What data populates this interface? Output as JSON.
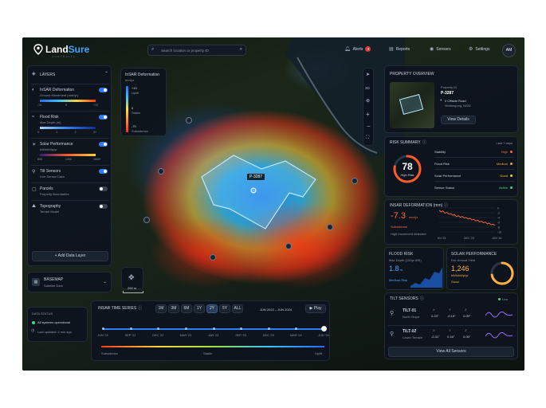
{
  "header": {
    "logo_land": "Land",
    "logo_sure": "Sure",
    "logo_sub": "AUSTRALIA",
    "search_placeholder": "Search location or property ID",
    "alerts": "Alerts",
    "alerts_count": "3",
    "reports": "Reports",
    "sensors": "Sensors",
    "settings": "Settings",
    "avatar": "AM"
  },
  "layers": {
    "title": "LAYERS",
    "items": [
      {
        "name": "InSAR Deformation",
        "sub": "Ground Movement (mm/yr)",
        "ticks": [
          "-70",
          "0",
          "+10"
        ],
        "on": true
      },
      {
        "name": "Flood Risk",
        "sub": "Max Depth (m)",
        "ticks": [
          "0",
          "1",
          "2",
          "3+"
        ],
        "on": true
      },
      {
        "name": "Solar Performance",
        "sub": "kWh/kWp/yr",
        "ticks": [
          "800",
          "1200",
          "1600+"
        ],
        "on": true
      },
      {
        "name": "Tilt Sensors",
        "sub": "Live Sensor Data",
        "on": true
      },
      {
        "name": "Parcels",
        "sub": "Property Boundaries",
        "on": false
      },
      {
        "name": "Topography",
        "sub": "Terrain Model",
        "on": false
      }
    ],
    "add": "+ Add Data Layer"
  },
  "basemap": {
    "title": "BASEMAP",
    "value": "Satellite Dark"
  },
  "data_status": {
    "title": "DATA STATUS",
    "status": "All systems operational",
    "updated": "Last updated: 2 min ago"
  },
  "legend": {
    "title": "InSAR Deformation",
    "unit": "mm/yr",
    "labels": [
      "+10",
      "Uplift",
      "0",
      "Stable",
      "-70",
      "Subsidence"
    ]
  },
  "map": {
    "parcel_label": "P-3287",
    "scale": "200 m",
    "tools": [
      "3D"
    ]
  },
  "timeseries": {
    "title": "INSAR TIME SERIES",
    "ranges": [
      "1M",
      "3M",
      "6M",
      "1Y",
      "2Y",
      "5Y",
      "ALL"
    ],
    "active": "2Y",
    "period": "JUN 2022 – JUN 2024",
    "play": "Play",
    "dates": [
      "JUN '22",
      "SEP '22",
      "DEC '22",
      "MAR '23",
      "JUN '23",
      "SEP '23",
      "DEC '23",
      "MAR '24",
      "JUN '24"
    ],
    "legend": [
      "Subsidence",
      "Stable",
      "Uplift"
    ]
  },
  "property": {
    "title": "PROPERTY OVERVIEW",
    "id_label": "Property ID",
    "id": "P-3287",
    "address1": "0 Offside Road",
    "address2": "Wollongong, NSW",
    "details_btn": "View Details"
  },
  "risk": {
    "title": "RISK SUMMARY",
    "period": "Last 7 days",
    "score": "78",
    "score_label": "High Risk",
    "score_fraction": 0.78,
    "rows": [
      {
        "label": "Stability",
        "value": "High",
        "color": "#ff6a3c"
      },
      {
        "label": "Flood Risk",
        "value": "Medium",
        "color": "#f2a52c"
      },
      {
        "label": "Solar Performance",
        "value": "Good",
        "color": "#f2d22c"
      },
      {
        "label": "Sensor Status",
        "value": "Active",
        "color": "#3ddc84"
      }
    ]
  },
  "insar": {
    "title": "INSAR DEFORMATION (mm)",
    "value": "-7.3",
    "unit": "mm/yr",
    "status": "Subsidence",
    "note": "High movement detected",
    "x_ticks": [
      "JUN '23",
      "DEC '23",
      "JUN '24"
    ],
    "y_ticks": [
      "0",
      "-2",
      "-4",
      "-6",
      "-8",
      "-10"
    ],
    "series": [
      -1.0,
      -1.6,
      -1.2,
      -2.2,
      -1.8,
      -2.6,
      -2.4,
      -3.0,
      -2.8,
      -3.6,
      -3.2,
      -3.9,
      -3.5,
      -4.2,
      -4.0,
      -4.6,
      -4.3,
      -5.0,
      -4.7,
      -5.4,
      -5.1,
      -5.8,
      -5.5,
      -6.2,
      -5.9,
      -6.6,
      -6.3,
      -7.0,
      -6.8,
      -7.3
    ]
  },
  "flood": {
    "title": "FLOOD RISK",
    "sub": "Max Depth (100yr ARI)",
    "value": "1.8",
    "unit": "m",
    "level": "Medium Risk"
  },
  "solar": {
    "title": "SOLAR PERFORMANCE",
    "sub": "Est. Annual Yield",
    "value": "1,246",
    "unit": "kWh/kWp/yr",
    "level": "Good",
    "fraction": 0.72
  },
  "tilt": {
    "title": "TILT SENSORS",
    "live": "Live",
    "axes": [
      "X",
      "Y",
      "Z"
    ],
    "sensors": [
      {
        "name": "TILT-01",
        "loc": "North Slope",
        "x": "0.23°",
        "y": "-0.15°",
        "z": "0.05°"
      },
      {
        "name": "TILT-02",
        "loc": "Lower Terrace",
        "x": "-0.31°",
        "y": "0.18°",
        "z": "0.05°"
      }
    ],
    "view_all": "View All Sensors"
  },
  "colors": {
    "accent": "#2f7df6",
    "danger": "#ff4d4d",
    "warning": "#f2a52c",
    "good": "#3ddc84",
    "panel": "#0e141e"
  }
}
